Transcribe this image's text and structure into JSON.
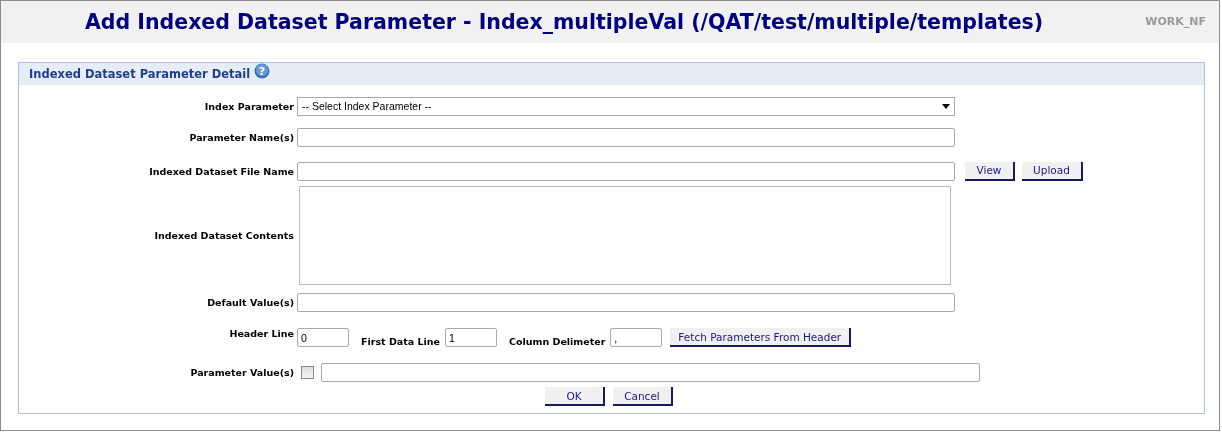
{
  "header": {
    "title": "Add Indexed Dataset Parameter - Index_multipleVal (/QAT/test/multiple/templates)",
    "workspace": "WORK_NF"
  },
  "panel": {
    "title": "Indexed Dataset Parameter Detail",
    "help": "?",
    "index_parameter": {
      "label": "Index Parameter",
      "value": "-- Select Index Parameter --"
    },
    "parameter_names": {
      "label": "Parameter Name(s)"
    },
    "file_name": {
      "label": "Indexed Dataset File Name",
      "buttons": [
        "View",
        "Upload"
      ]
    },
    "contents": {
      "label": "Indexed Dataset Contents"
    },
    "default_values": {
      "label": "Default Value(s)"
    },
    "header_line": {
      "label": "Header Line",
      "value": "0"
    },
    "first_data_line": {
      "label": "First Data Line",
      "value": "1"
    },
    "column_delimiter": {
      "label": "Column Delimeter",
      "value": ","
    },
    "fetch_button": "Fetch Parameters From Header",
    "parameter_values": {
      "label": "Parameter Value(s)",
      "checked": false
    },
    "buttons": [
      "OK",
      "Cancel"
    ]
  }
}
